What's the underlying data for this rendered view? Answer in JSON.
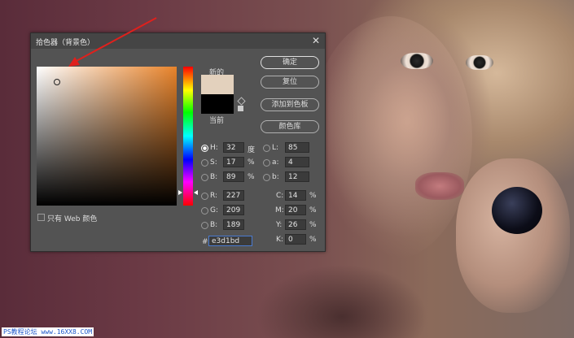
{
  "dialog": {
    "title": "拾色器（背景色）",
    "close_icon": "close-icon",
    "new_label": "新的",
    "current_label": "当前",
    "new_color": "#e3d1bd",
    "current_color": "#000000",
    "web_only_label": "只有 Web 颜色"
  },
  "buttons": {
    "ok": "确定",
    "reset": "复位",
    "add_swatch": "添加到色板",
    "color_libraries": "颜色库"
  },
  "hsb": {
    "h_label": "H:",
    "h_value": "32",
    "h_unit": "度",
    "s_label": "S:",
    "s_value": "17",
    "s_unit": "%",
    "b_label": "B:",
    "b_value": "89",
    "b_unit": "%"
  },
  "rgb": {
    "r_label": "R:",
    "r_value": "227",
    "g_label": "G:",
    "g_value": "209",
    "b_label": "B:",
    "b_value": "189"
  },
  "lab": {
    "l_label": "L:",
    "l_value": "85",
    "a_label": "a:",
    "a_value": "4",
    "b_label": "b:",
    "b_value": "12"
  },
  "cmyk": {
    "c_label": "C:",
    "c_value": "14",
    "c_unit": "%",
    "m_label": "M:",
    "m_value": "20",
    "m_unit": "%",
    "y_label": "Y:",
    "y_value": "26",
    "y_unit": "%",
    "k_label": "K:",
    "k_value": "0",
    "k_unit": "%"
  },
  "hex": {
    "label": "#",
    "value": "e3d1bd"
  },
  "watermark": "PS教程论坛 www.16XX8.COM",
  "colors": {
    "arrow": "#e0201c",
    "dialog_bg": "#535353"
  }
}
